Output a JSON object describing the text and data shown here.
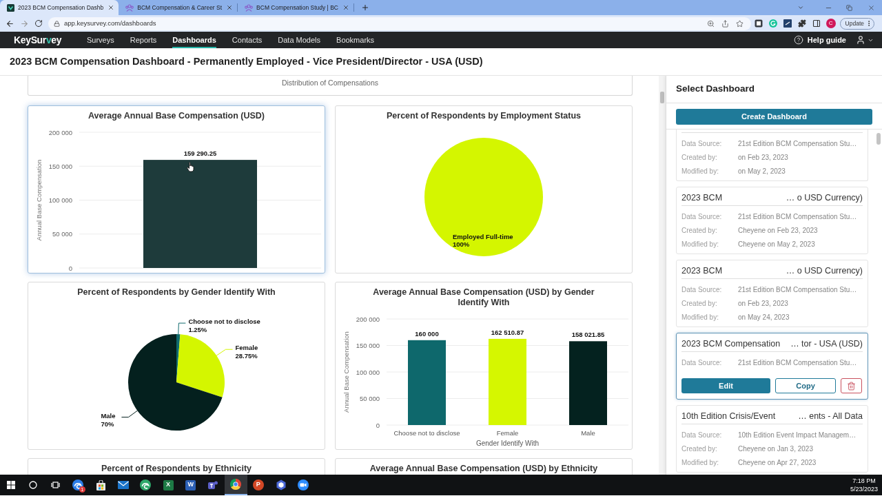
{
  "browser": {
    "tabs": [
      {
        "kind": "tile",
        "title": "2023 BCM Compensation Dashb",
        "selected": true
      },
      {
        "kind": "people",
        "title": "BCM Compensation & Career St",
        "selected": false
      },
      {
        "kind": "people",
        "title": "BCM Compensation Study | BC",
        "selected": false
      }
    ],
    "address": "app.keysurvey.com/dashboards",
    "profile_initial": "C",
    "update_label": "Update"
  },
  "app_nav": {
    "logo": {
      "before": "KeySur",
      "accent": "v",
      "after": "ey"
    },
    "items": [
      {
        "label": "Surveys",
        "selected": false
      },
      {
        "label": "Reports",
        "selected": false
      },
      {
        "label": "Dashboards",
        "selected": true
      },
      {
        "label": "Contacts",
        "selected": false
      },
      {
        "label": "Data Models",
        "selected": false
      },
      {
        "label": "Bookmarks",
        "selected": false
      }
    ],
    "help_label": "Help guide"
  },
  "page_title": "2023 BCM Compensation Dashboard - Permanently Employed - Vice President/Director - USA (USD)",
  "dashboard": {
    "caption": "Distribution of Compensations",
    "charts": [
      {
        "title": "Average Annual Base Compensation (USD)",
        "hovered": true,
        "chart_data": {
          "type": "bar",
          "ylabel": "Annual Base Compensation",
          "values": [
            159290.25
          ],
          "colors": [
            "#1e3b3b"
          ],
          "ylim": [
            0,
            200000
          ],
          "yticks": [
            {
              "value": 0,
              "label": "0"
            },
            {
              "value": 50000,
              "label": "50 000"
            },
            {
              "value": 100000,
              "label": "100 000"
            },
            {
              "value": 150000,
              "label": "150 000"
            },
            {
              "value": 200000,
              "label": "200 000"
            }
          ],
          "grid": true,
          "value_labels": [
            "159 290.25"
          ]
        }
      },
      {
        "title": "Percent of Respondents by Employment Status",
        "hovered": false,
        "chart_data": {
          "type": "pie",
          "categories": [
            "Employed Full-time"
          ],
          "values": [
            100
          ],
          "colors": [
            "#d4f600"
          ],
          "value_labels": [
            "100%"
          ]
        }
      },
      {
        "title": "Percent of Respondents by Gender Identify With",
        "hovered": false,
        "chart_data": {
          "type": "pie",
          "categories": [
            "Choose not to disclose",
            "Female",
            "Male"
          ],
          "values": [
            1.25,
            28.75,
            70
          ],
          "colors": [
            "#0f6a6d",
            "#d4f600",
            "#04201e"
          ],
          "value_labels": [
            "1.25%",
            "28.75%",
            "70%"
          ]
        }
      },
      {
        "title": "Average Annual Base Compensation (USD) by Gender Identify With",
        "hovered": false,
        "chart_data": {
          "type": "bar",
          "xlabel": "Gender Identify With",
          "ylabel": "Annual Base Compensation",
          "categories": [
            "Choose not to disclose",
            "Female",
            "Male"
          ],
          "values": [
            160000,
            162510.87,
            158021.85
          ],
          "colors": [
            "#0e686c",
            "#d5f700",
            "#04221f"
          ],
          "ylim": [
            0,
            200000
          ],
          "yticks": [
            {
              "value": 0,
              "label": "0"
            },
            {
              "value": 50000,
              "label": "50 000"
            },
            {
              "value": 100000,
              "label": "100 000"
            },
            {
              "value": 150000,
              "label": "150 000"
            },
            {
              "value": 200000,
              "label": "200 000"
            }
          ],
          "grid": true,
          "value_labels": [
            "160 000",
            "162 510.87",
            "158 021.85"
          ]
        }
      }
    ],
    "more_titles": [
      "Percent of Respondents by Ethnicity",
      "Average Annual Base Compensation (USD) by Ethnicity"
    ]
  },
  "sidebar": {
    "title": "Select Dashboard",
    "create_label": "Create Dashboard",
    "items": [
      {
        "selected": false,
        "rows": [
          {
            "label": "Data Source:",
            "value": "21st Edition BCM Compensation Stu…"
          },
          {
            "label": "Created by:",
            "value": "on Feb 23, 2023"
          },
          {
            "label": "Modified by:",
            "value": "on May 2, 2023"
          }
        ]
      },
      {
        "title_start": "2023 BCM",
        "title_end": "… o USD Currency)",
        "selected": false,
        "rows": [
          {
            "label": "Data Source:",
            "value": "21st Edition BCM Compensation Stu…"
          },
          {
            "label": "Created by:",
            "value": "Cheyene on Feb 23, 2023"
          },
          {
            "label": "Modified by:",
            "value": "Cheyene on May 2, 2023"
          }
        ]
      },
      {
        "title_start": "2023 BCM",
        "title_end": "… o USD Currency)",
        "selected": false,
        "rows": [
          {
            "label": "Data Source:",
            "value": "21st Edition BCM Compensation Stu…"
          },
          {
            "label": "Created by:",
            "value": "on Feb 23, 2023"
          },
          {
            "label": "Modified by:",
            "value": "on May 24, 2023"
          }
        ]
      },
      {
        "title_start": "2023 BCM Compensation",
        "title_end": "… tor - USA (USD)",
        "selected": true,
        "rows": [
          {
            "label": "Data Source:",
            "value": "21st Edition BCM Compensation Stu…"
          }
        ],
        "actions": [
          {
            "kind": "primary",
            "label": "Edit"
          },
          {
            "kind": "outline",
            "label": "Copy"
          },
          {
            "kind": "delete"
          }
        ]
      },
      {
        "title_start": "10th Edition Crisis/Event",
        "title_end": "… ents - All Data",
        "selected": false,
        "rows": [
          {
            "label": "Data Source:",
            "value": "10th Edition Event Impact Managem…"
          },
          {
            "label": "Created by:",
            "value": "Cheyene on Jan 3, 2023"
          },
          {
            "label": "Modified by:",
            "value": "Cheyene on Apr 27, 2023"
          }
        ]
      }
    ]
  },
  "taskbar": {
    "apps": [
      {
        "kind": "swirl",
        "color": "#2b7de9",
        "badge": "1",
        "selected": false
      },
      {
        "kind": "bag",
        "selected": false
      },
      {
        "kind": "mail",
        "color": "#1a73c8",
        "selected": false
      },
      {
        "kind": "swirl",
        "color": "#2fa86b",
        "selected": false
      },
      {
        "kind": "tile",
        "color": "#1d7a45",
        "label": "X",
        "selected": false
      },
      {
        "kind": "tile",
        "color": "#2b5fb4",
        "label": "W",
        "selected": false
      },
      {
        "kind": "people",
        "color": "#5b5fc7",
        "selected": false
      },
      {
        "kind": "ring",
        "selected": true
      },
      {
        "kind": "disc",
        "color": "#d24726",
        "label": "P",
        "selected": false
      },
      {
        "kind": "hexagon",
        "color": "#4a67d6",
        "selected": false
      },
      {
        "kind": "camera",
        "color": "#2d8cff",
        "selected": false
      }
    ],
    "time": "7:18 PM",
    "date": "5/23/2023"
  }
}
